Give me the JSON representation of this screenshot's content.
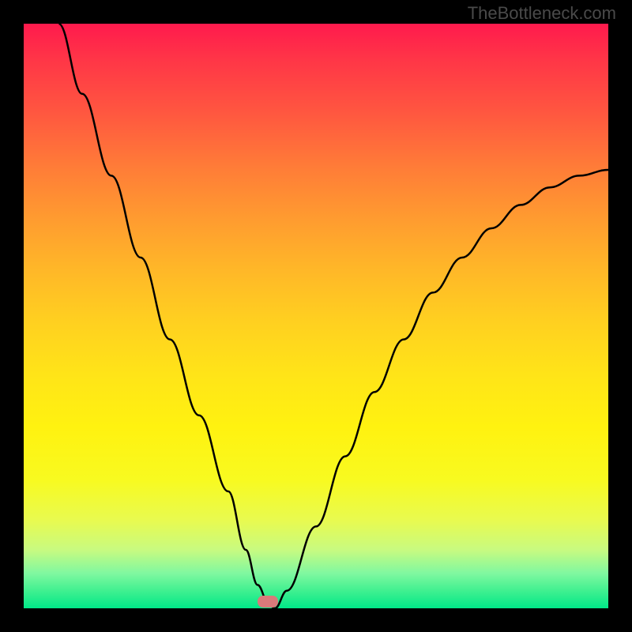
{
  "watermark": "TheBottleneck.com",
  "chart_data": {
    "type": "line",
    "title": "",
    "xlabel": "",
    "ylabel": "",
    "xlim": [
      0,
      100
    ],
    "ylim": [
      0,
      100
    ],
    "series": [
      {
        "name": "bottleneck-curve",
        "x": [
          6,
          10,
          15,
          20,
          25,
          30,
          35,
          38,
          40,
          42,
          43,
          45,
          50,
          55,
          60,
          65,
          70,
          75,
          80,
          85,
          90,
          95,
          100
        ],
        "y": [
          100,
          88,
          74,
          60,
          46,
          33,
          20,
          10,
          4,
          0.5,
          0,
          3,
          14,
          26,
          37,
          46,
          54,
          60,
          65,
          69,
          72,
          74,
          75
        ]
      }
    ],
    "marker": {
      "x": 42,
      "y": 0
    },
    "gradient_colors": {
      "top": "#ff1a4d",
      "mid": "#ffe418",
      "bottom": "#00e888"
    }
  }
}
